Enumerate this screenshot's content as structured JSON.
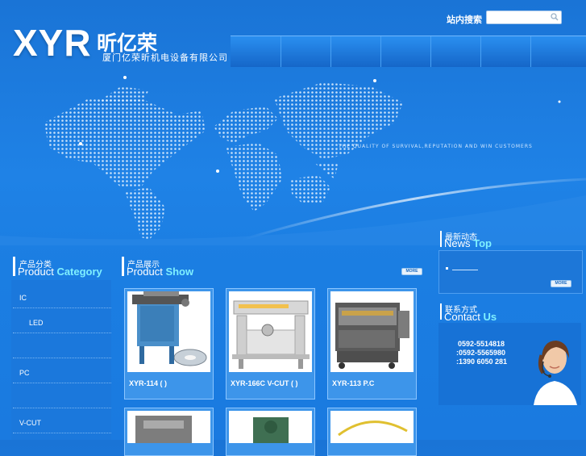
{
  "header": {
    "logo_text": "XYR",
    "logo_cn": "昕亿荣",
    "company_name": "厦门亿荣昕机电设备有限公司",
    "search_label": "站内搜索",
    "search_placeholder": ""
  },
  "banner": {
    "tagline": "THE QUALITY OF SURVIVAL,REPUTATION AND WIN CUSTOMERS"
  },
  "category": {
    "title_cn": "产品分类",
    "title_en_1": "Product",
    "title_en_2": "Category",
    "items": [
      "IC",
      "LED",
      "",
      "PC",
      "",
      "V-CUT"
    ]
  },
  "products": {
    "title_cn": "产品展示",
    "title_en_1": "Product",
    "title_en_2": "Show",
    "more_label": "MORE",
    "items": [
      {
        "caption": "XYR-114          (       )"
      },
      {
        "caption": "XYR-166C V-CUT         (       )"
      },
      {
        "caption": "XYR-113       P.C"
      }
    ]
  },
  "news": {
    "title_cn": "最新动态",
    "title_en_1": "News",
    "title_en_2": "Top",
    "more_label": "MORE"
  },
  "contact": {
    "title_cn": "联系方式",
    "title_en_1": "Contact",
    "title_en_2": "Us",
    "phones": [
      "0592-5514818",
      ":0592-5565980",
      ":1390 6050 281"
    ]
  },
  "colors": {
    "accent": "#7ff0ff",
    "background": "#1f82e6"
  }
}
